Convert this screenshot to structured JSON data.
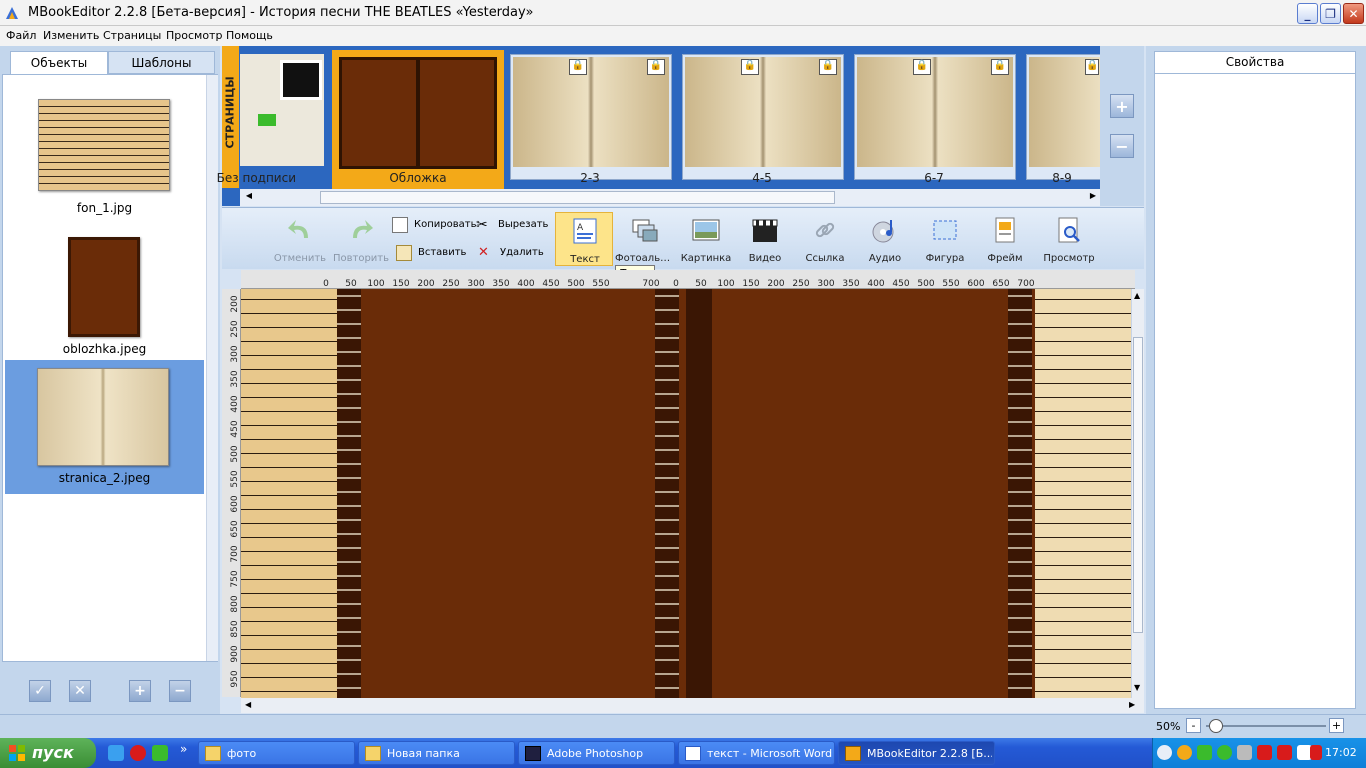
{
  "window": {
    "title": "MBookEditor 2.2.8 [Бета-версия] - История песни THE BEATLES «Yesterday»"
  },
  "menu": [
    "Файл",
    "Изменить",
    "Страницы",
    "Просмотр",
    "Помощь"
  ],
  "left_panel": {
    "tabs": [
      "Объекты",
      "Шаблоны"
    ],
    "items": [
      {
        "label": "fon_1.jpg",
        "selected": false
      },
      {
        "label": "oblozhka.jpeg",
        "selected": false
      },
      {
        "label": "stranica_2.jpeg",
        "selected": true
      }
    ]
  },
  "pages": {
    "tab_label": "СТРАНИЦЫ",
    "items": [
      {
        "label": "Без подписи",
        "selected": false,
        "locked": false
      },
      {
        "label": "Обложка",
        "selected": true,
        "locked": false
      },
      {
        "label": "2-3",
        "selected": false,
        "locked": true
      },
      {
        "label": "4-5",
        "selected": false,
        "locked": true
      },
      {
        "label": "6-7",
        "selected": false,
        "locked": true
      },
      {
        "label": "8-9",
        "selected": false,
        "locked": true
      }
    ]
  },
  "toolbar": {
    "undo": "Отменить",
    "redo": "Повторить",
    "copy": "Копировать",
    "paste": "Вставить",
    "cut": "Вырезать",
    "delete": "Удалить",
    "text": "Текст",
    "photoalbum": "Фотоальбом",
    "picture": "Картинка",
    "video": "Видео",
    "link": "Ссылка",
    "audio": "Аудио",
    "shape": "Фигура",
    "frame": "Фрейм",
    "preview": "Просмотр",
    "tooltip": "Текст"
  },
  "rulers": {
    "h_ticks": [
      "0",
      "50",
      "100",
      "150",
      "200",
      "250",
      "300",
      "350",
      "400",
      "450",
      "500",
      "550",
      "700",
      "0",
      "50",
      "100",
      "150",
      "200",
      "250",
      "300",
      "350",
      "400",
      "450",
      "500",
      "550",
      "600",
      "650",
      "700"
    ],
    "v_ticks": [
      "200",
      "250",
      "300",
      "350",
      "400",
      "450",
      "500",
      "550",
      "600",
      "650",
      "700",
      "750",
      "800",
      "850",
      "900",
      "950"
    ]
  },
  "right_panel": {
    "tab": "Свойства"
  },
  "status": {
    "zoom": "50%",
    "zoom_fraction": 0.08
  },
  "taskbar": {
    "start": "пуск",
    "tasks": [
      {
        "label": "фото",
        "active": false
      },
      {
        "label": "Новая папка",
        "active": false
      },
      {
        "label": "Adobe Photoshop",
        "active": false
      },
      {
        "label": "текст - Microsoft Word",
        "active": false
      },
      {
        "label": "MBookEditor 2.2.8 [Б...",
        "active": true
      }
    ],
    "clock": "17:02"
  },
  "colors": {
    "accent_orange": "#f3a918",
    "selection_blue": "#6b9de0",
    "cover_brown": "#6a2c08",
    "strip_blue": "#2c67bf"
  }
}
